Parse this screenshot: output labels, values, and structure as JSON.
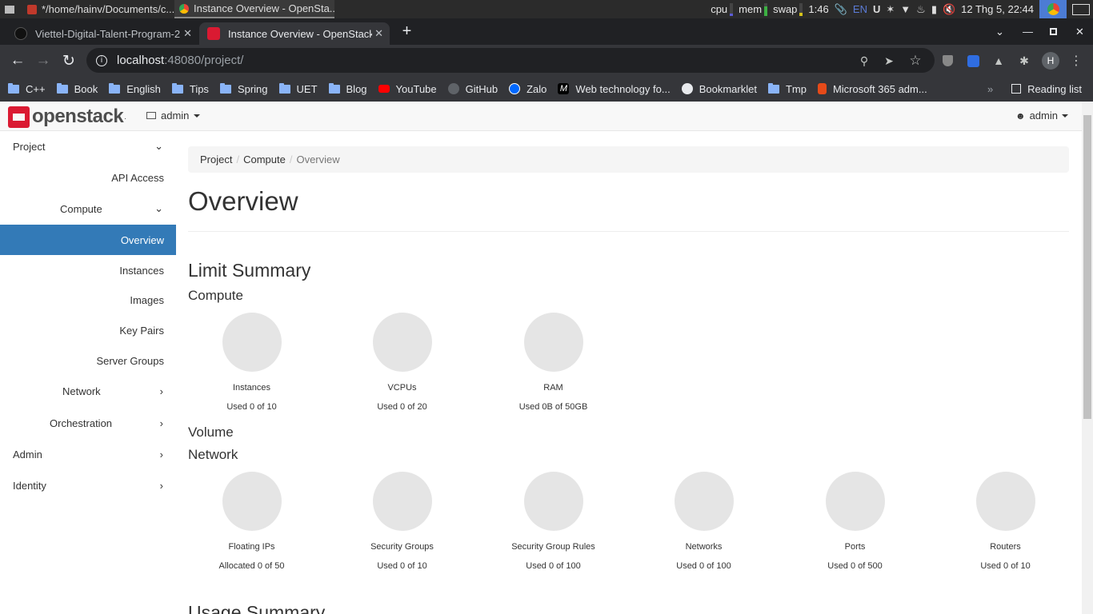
{
  "os_panel": {
    "tasks": [
      {
        "title": "*/home/hainv/Documents/c..."
      },
      {
        "title": "Instance Overview - OpenSta..."
      }
    ],
    "cpu_label": "cpu",
    "mem_label": "mem",
    "swap_label": "swap",
    "battery_time": "1:46",
    "lang": "EN",
    "datetime": "12 Thg 5, 22:44"
  },
  "browser": {
    "tabs": [
      {
        "title": "Viettel-Digital-Talent-Program-2"
      },
      {
        "title": "Instance Overview - OpenStack"
      }
    ],
    "new_tab_symbol": "+",
    "url_host": "localhost",
    "url_path": ":48080/project/",
    "profile_initial": "H",
    "bookmarks": [
      {
        "label": "C++",
        "icon": "folder"
      },
      {
        "label": "Book",
        "icon": "folder"
      },
      {
        "label": "English",
        "icon": "folder"
      },
      {
        "label": "Tips",
        "icon": "folder"
      },
      {
        "label": "Spring",
        "icon": "folder"
      },
      {
        "label": "UET",
        "icon": "folder"
      },
      {
        "label": "Blog",
        "icon": "folder"
      },
      {
        "label": "YouTube",
        "icon": "youtube"
      },
      {
        "label": "GitHub",
        "icon": "github"
      },
      {
        "label": "Zalo",
        "icon": "zalo"
      },
      {
        "label": "Web technology fo...",
        "icon": "mdn"
      },
      {
        "label": "Bookmarklet",
        "icon": "globe"
      },
      {
        "label": "Tmp",
        "icon": "folder"
      },
      {
        "label": "Microsoft 365 adm...",
        "icon": "office"
      }
    ],
    "more_bookmarks": "»",
    "reading_list": "Reading list"
  },
  "header": {
    "logo_text": "openstack",
    "project_selector": "admin",
    "user_menu": "admin"
  },
  "sidebar": {
    "items": [
      {
        "label": "Project",
        "chevron": "down"
      },
      {
        "label": "API Access"
      },
      {
        "label": "Compute",
        "chevron": "down"
      },
      {
        "label": "Overview",
        "active": true
      },
      {
        "label": "Instances"
      },
      {
        "label": "Images"
      },
      {
        "label": "Key Pairs"
      },
      {
        "label": "Server Groups"
      },
      {
        "label": "Network",
        "chevron": "right"
      },
      {
        "label": "Orchestration",
        "chevron": "right"
      },
      {
        "label": "Admin",
        "chevron": "right"
      },
      {
        "label": "Identity",
        "chevron": "right"
      }
    ]
  },
  "breadcrumb": {
    "items": [
      "Project",
      "Compute"
    ],
    "separator": "/",
    "current": "Overview"
  },
  "main": {
    "title": "Overview",
    "limit_summary": "Limit Summary",
    "compute_heading": "Compute",
    "compute": [
      {
        "title": "Instances",
        "used": "Used 0 of 10"
      },
      {
        "title": "VCPUs",
        "used": "Used 0 of 20"
      },
      {
        "title": "RAM",
        "used": "Used 0B of 50GB"
      }
    ],
    "volume_heading": "Volume",
    "network_heading": "Network",
    "network": [
      {
        "title": "Floating IPs",
        "used": "Allocated 0 of 50"
      },
      {
        "title": "Security Groups",
        "used": "Used 0 of 10"
      },
      {
        "title": "Security Group Rules",
        "used": "Used 0 of 100"
      },
      {
        "title": "Networks",
        "used": "Used 0 of 100"
      },
      {
        "title": "Ports",
        "used": "Used 0 of 500"
      },
      {
        "title": "Routers",
        "used": "Used 0 of 10"
      }
    ],
    "usage_summary": "Usage Summary"
  },
  "colors": {
    "active_nav": "#337ab7",
    "logo_red": "#da1a32",
    "pie_fill": "#e5e5e5"
  }
}
